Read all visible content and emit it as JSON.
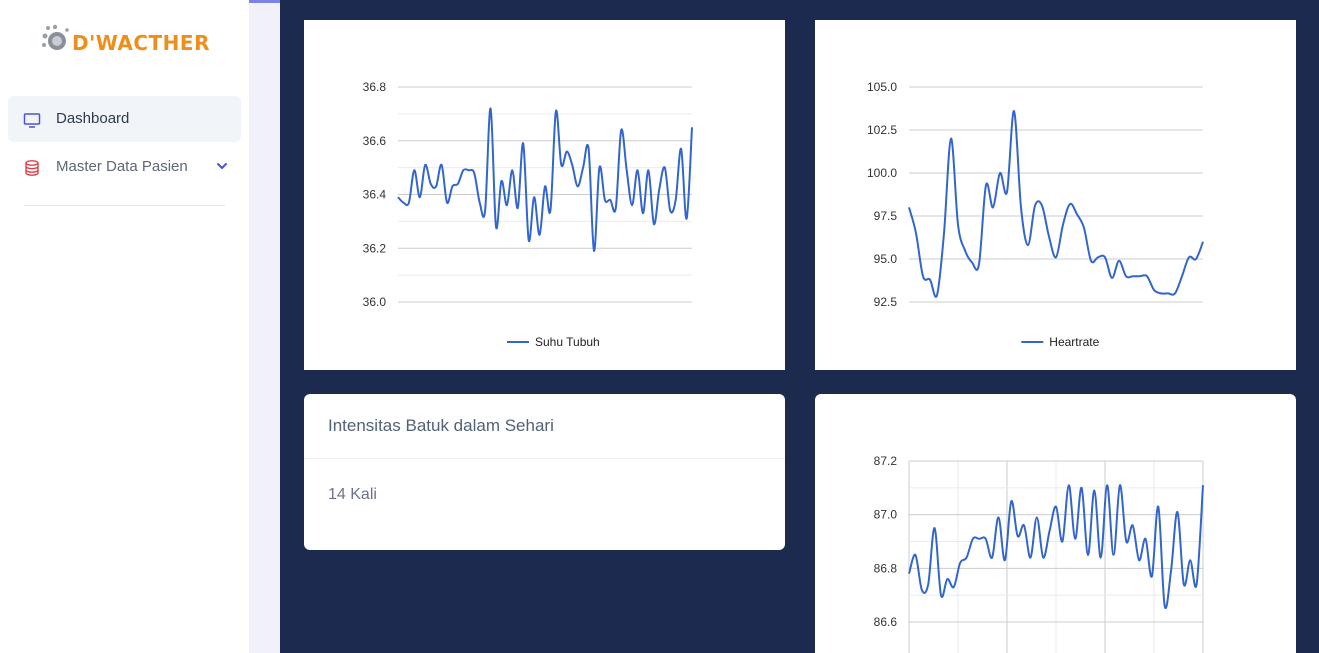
{
  "brand": {
    "name": "D'WACTHER",
    "color": "#ef8e1b"
  },
  "sidebar": {
    "items": [
      {
        "label": "Dashboard",
        "icon": "monitor-icon",
        "active": true
      },
      {
        "label": "Master Data Pasien",
        "icon": "database-icon",
        "active": false,
        "has_dropdown": true
      }
    ]
  },
  "info_card": {
    "title": "Intensitas Batuk dalam Sehari",
    "value": "14 Kali"
  },
  "chart_data": [
    {
      "type": "line",
      "series": [
        {
          "name": "Suhu Tubuh",
          "color": "#3366cc",
          "values": [
            36.39,
            36.37,
            36.37,
            36.49,
            36.39,
            36.51,
            36.44,
            36.43,
            36.51,
            36.37,
            36.43,
            36.44,
            36.49,
            36.49,
            36.48,
            36.37,
            36.34,
            36.72,
            36.28,
            36.45,
            36.36,
            36.49,
            36.35,
            36.59,
            36.23,
            36.39,
            36.25,
            36.43,
            36.34,
            36.71,
            36.51,
            36.56,
            36.51,
            36.43,
            36.5,
            36.57,
            36.19,
            36.5,
            36.38,
            36.38,
            36.35,
            36.64,
            36.49,
            36.36,
            36.49,
            36.33,
            36.49,
            36.29,
            36.42,
            36.5,
            36.34,
            36.38,
            36.57,
            36.31,
            36.65
          ]
        }
      ],
      "yticks": [
        "36.0",
        "36.2",
        "36.4",
        "36.6",
        "36.8"
      ],
      "ylim": [
        36.0,
        36.8
      ],
      "legend": "bottom",
      "grid": true
    },
    {
      "type": "line",
      "series": [
        {
          "name": "Heartrate",
          "color": "#3366cc",
          "values": [
            98.0,
            96.5,
            94.0,
            93.8,
            92.9,
            96.5,
            102.0,
            97.0,
            95.5,
            94.8,
            94.7,
            99.3,
            98.0,
            100.0,
            98.9,
            103.6,
            98.0,
            95.8,
            98.1,
            98.1,
            96.3,
            95.1,
            97.0,
            98.2,
            97.6,
            96.8,
            94.9,
            95.1,
            95.1,
            93.9,
            94.9,
            94.0,
            94.0,
            94.0,
            94.0,
            93.2,
            93.0,
            93.0,
            93.0,
            94.0,
            95.1,
            95.0,
            96.0
          ]
        }
      ],
      "yticks": [
        "92.5",
        "95.0",
        "97.5",
        "100.0",
        "102.5",
        "105.0"
      ],
      "ylim": [
        92.5,
        105.0
      ],
      "legend": "bottom",
      "grid": true
    },
    {
      "type": "line",
      "series": [
        {
          "color": "#3366cc",
          "values": [
            86.78,
            86.85,
            86.72,
            86.74,
            86.95,
            86.7,
            86.76,
            86.73,
            86.82,
            86.84,
            86.91,
            86.91,
            86.91,
            86.84,
            86.99,
            86.83,
            87.05,
            86.92,
            86.96,
            86.84,
            86.99,
            86.84,
            86.94,
            87.03,
            86.9,
            87.11,
            86.91,
            87.1,
            86.85,
            87.09,
            86.84,
            87.11,
            86.85,
            87.11,
            86.9,
            86.96,
            86.83,
            86.91,
            86.77,
            87.03,
            86.66,
            86.79,
            87.01,
            86.74,
            86.83,
            86.74,
            87.11
          ]
        }
      ],
      "yticks": [
        "86.6",
        "86.8",
        "87.0",
        "87.2"
      ],
      "ylim": [
        86.6,
        87.2
      ],
      "grid": true
    }
  ]
}
